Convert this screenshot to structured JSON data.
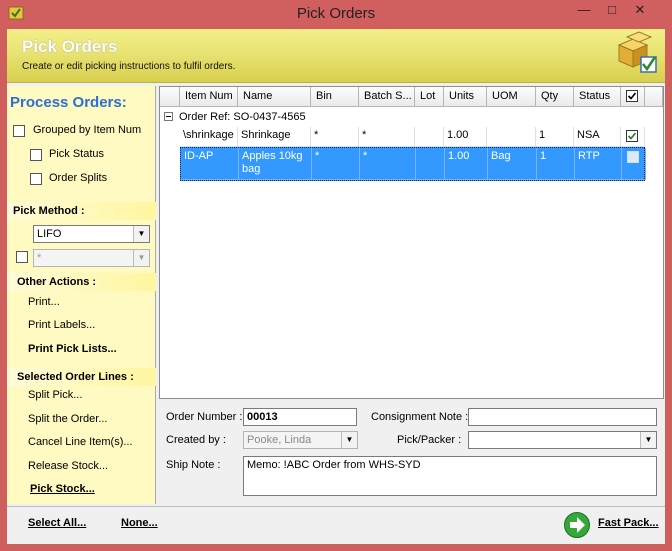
{
  "window": {
    "title": "Pick Orders",
    "min_glyph": "—",
    "max_glyph": "□",
    "close_glyph": "✕"
  },
  "header": {
    "title": "Pick Orders",
    "subtitle": "Create or edit picking instructions to fulfil orders."
  },
  "sidebar": {
    "title": "Process Orders:",
    "grouped_label": "Grouped by Item Num",
    "pick_status_label": "Pick Status",
    "order_splits_label": "Order Splits",
    "pick_method_heading": "Pick Method :",
    "pick_method_value": "LIFO",
    "second_combo_value": "*",
    "other_actions_heading": "Other Actions :",
    "print_label": "Print...",
    "print_labels_label": "Print Labels...",
    "print_pick_lists_label": "Print Pick Lists...",
    "selected_lines_heading": "Selected Order Lines :",
    "split_pick_label": "Split Pick...",
    "split_order_label": "Split the Order...",
    "cancel_line_label": "Cancel Line Item(s)...",
    "release_stock_label": "Release Stock...",
    "pick_stock_label": "Pick Stock..."
  },
  "grid": {
    "columns": [
      "Item Num",
      "Name",
      "Bin",
      "Batch S...",
      "Lot",
      "Units",
      "UOM",
      "Qty",
      "Status"
    ],
    "group_label": "Order Ref: SO-0437-4565",
    "rows": [
      {
        "item": "\\shrinkage",
        "name": "Shrinkage",
        "bin": "*",
        "batch": "*",
        "lot": "",
        "units": "1.00",
        "uom": "",
        "qty": "1",
        "status": "NSA",
        "checked": true
      },
      {
        "item": "ID-AP",
        "name": "Apples 10kg bag",
        "bin": "*",
        "batch": "*",
        "lot": "",
        "units": "1.00",
        "uom": "Bag",
        "qty": "1",
        "status": "RTP",
        "checked": false
      }
    ]
  },
  "form": {
    "order_number_label": "Order Number :",
    "order_number_value": "00013",
    "consignment_label": "Consignment Note :",
    "consignment_value": "",
    "created_by_label": "Created by :",
    "created_by_value": "Pooke, Linda",
    "pick_packer_label": "Pick/Packer :",
    "pick_packer_value": "",
    "ship_note_label": "Ship Note :",
    "ship_note_value": "Memo: !ABC Order from WHS-SYD"
  },
  "footer": {
    "select_all_label": "Select All...",
    "none_label": "None...",
    "fast_pack_label": "Fast Pack..."
  },
  "colors": {
    "selection": "#3399ff",
    "title_accent": "#2e6fd2",
    "header_yellow": "#e8e373",
    "sidebar_bg": "#fff9c2"
  }
}
